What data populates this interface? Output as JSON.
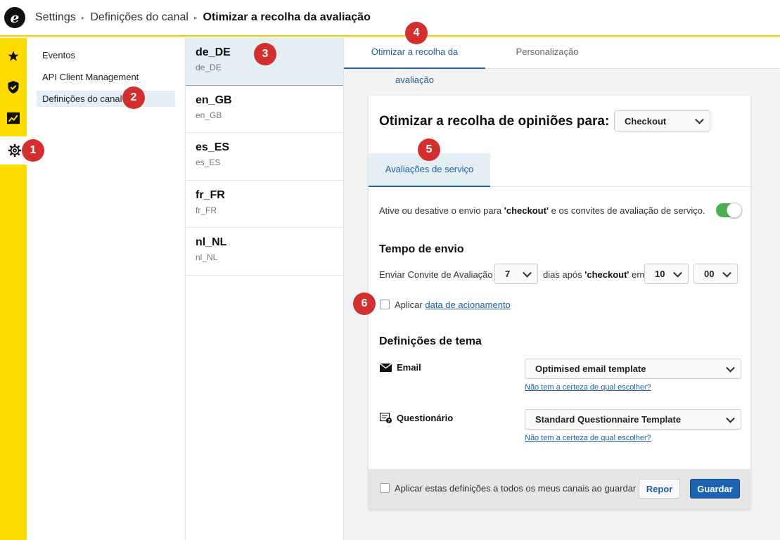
{
  "header": {
    "logo_letter": "e",
    "breadcrumb": [
      "Settings",
      "Definições do canal",
      "Otimizar a recolha da avaliação"
    ]
  },
  "rail": {
    "icons": [
      "star-icon",
      "shield-check-icon",
      "chart-icon",
      "gear-icon"
    ]
  },
  "nav": {
    "items": [
      "Eventos",
      "API Client Management",
      "Definições do canal"
    ]
  },
  "locales": [
    {
      "code": "de_DE",
      "sub": "de_DE"
    },
    {
      "code": "en_GB",
      "sub": "en_GB"
    },
    {
      "code": "es_ES",
      "sub": "es_ES"
    },
    {
      "code": "fr_FR",
      "sub": "fr_FR"
    },
    {
      "code": "nl_NL",
      "sub": "nl_NL"
    }
  ],
  "tabs": [
    "Otimizar a recolha da avaliação",
    "Personalização"
  ],
  "card": {
    "title": "Otimizar a recolha de opiniões para:",
    "trigger_select": "Checkout",
    "subtab": "Avaliações de serviço",
    "toggle_text_pre": "Ative ou desative o envio para ",
    "toggle_text_bold": "'checkout'",
    "toggle_text_post": " e os convites de avaliação de serviço.",
    "send_time_title": "Tempo de envio",
    "send_label": "Enviar Convite de Avaliação",
    "days_value": "7",
    "days_after_pre": "dias após ",
    "days_after_bold": "'checkout'",
    "days_after_post": " em",
    "hour_value": "10",
    "minute_value": "00",
    "apply_pre": "Aplicar ",
    "apply_link": "data de acionamento",
    "theme_title": "Definições de tema",
    "email_label": "Email",
    "email_template": "Optimised email template",
    "questionnaire_label": "Questionário",
    "questionnaire_template": "Standard Questionnaire Template",
    "help_link": "Não tem a certeza de qual escolher?",
    "footer_checkbox": "Aplicar estas definições a todos os meus canais ao guardar",
    "reset_label": "Repor",
    "save_label": "Guardar"
  },
  "markers": [
    "1",
    "2",
    "3",
    "4",
    "5",
    "6"
  ],
  "colors": {
    "accent": "#1f5f9e",
    "rail": "#ffdc00",
    "toggle_on": "#4caf50",
    "marker": "#d32f2f"
  }
}
